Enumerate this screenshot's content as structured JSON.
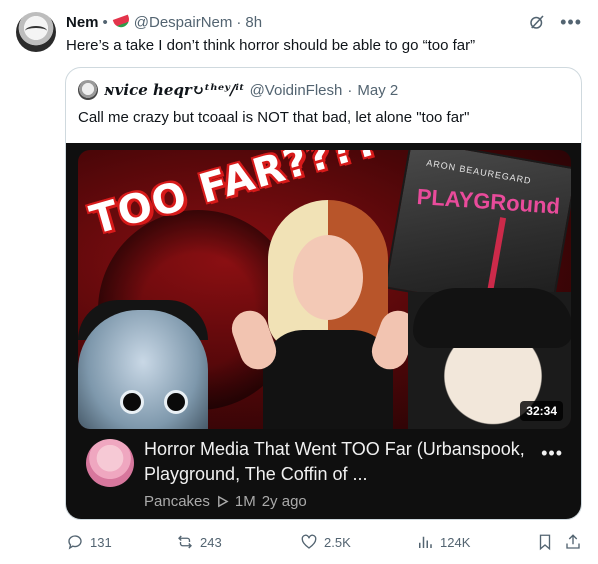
{
  "tweet": {
    "author_name": "Nem",
    "separator": "•",
    "emoji": "watermelon",
    "handle": "@DespairNem",
    "time_sep": "·",
    "time": "8h",
    "text": "Here’s a take I don’t think horror should be able to go “too far”",
    "icons": {
      "grok": "grok-slash-icon",
      "more": "more-icon"
    }
  },
  "quote": {
    "author_name": "ɴvice heqr↻ᵗʰᵉʸ/ⁱᵗ",
    "handle": "@VoidinFlesh",
    "time_sep": "·",
    "date": "May 2",
    "text": "Call me crazy but tcoaal is NOT that bad, let alone \"too far\""
  },
  "video": {
    "thumbnail_text": "TOO FAR????",
    "book_author": "ARON BEAUREGARD",
    "book_title": "PLAYGRound",
    "duration": "32:34",
    "title": "Horror Media That Went TOO Far (Urbanspook, Playground, The Coffin of ...",
    "channel": "Pancakes",
    "views": "1M",
    "age": "2y ago",
    "more": "•••"
  },
  "actions": {
    "replies": "131",
    "reposts": "243",
    "likes": "2.5K",
    "views": "124K"
  },
  "colors": {
    "text_primary": "#0f1419",
    "text_secondary": "#536471",
    "border": "#cfd9de",
    "yt_bg": "#0f0f0f"
  }
}
